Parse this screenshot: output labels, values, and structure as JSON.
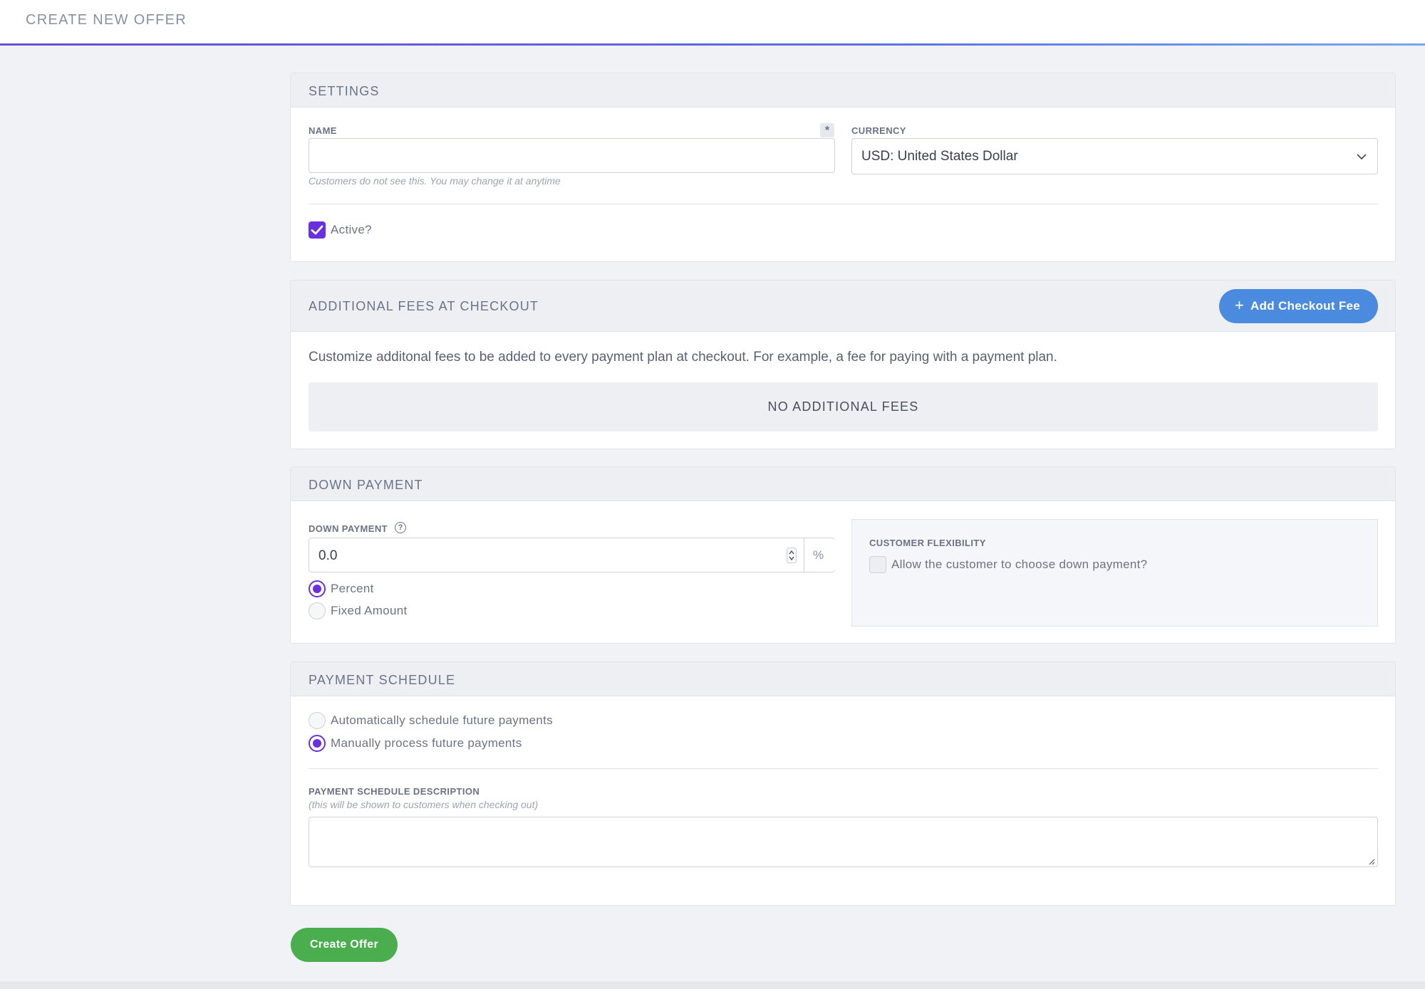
{
  "header": {
    "title": "CREATE NEW OFFER"
  },
  "settings": {
    "title": "SETTINGS",
    "name_label": "NAME",
    "required_marker": "*",
    "name_value": "",
    "name_hint": "Customers do not see this. You may change it at anytime",
    "currency_label": "CURRENCY",
    "currency_value": "USD: United States Dollar",
    "active_label": "Active?",
    "active_checked": true
  },
  "fees": {
    "title": "ADDITIONAL FEES AT CHECKOUT",
    "add_button_plus": "+",
    "add_button_label": "Add Checkout Fee",
    "description": "Customize additonal fees to be added to every payment plan at checkout. For example, a fee for paying with a payment plan.",
    "empty_text": "NO ADDITIONAL FEES"
  },
  "down_payment": {
    "title": "DOWN PAYMENT",
    "field_label": "DOWN PAYMENT",
    "help_glyph": "?",
    "value": "0.0",
    "unit": "%",
    "options": [
      {
        "label": "Percent",
        "selected": true
      },
      {
        "label": "Fixed Amount",
        "selected": false
      }
    ],
    "flex_title": "CUSTOMER FLEXIBILITY",
    "flex_label": "Allow the customer to choose down payment?",
    "flex_checked": false
  },
  "payment_schedule": {
    "title": "PAYMENT SCHEDULE",
    "options": [
      {
        "label": "Automatically schedule future payments",
        "selected": false
      },
      {
        "label": "Manually process future payments",
        "selected": true
      }
    ],
    "desc_label": "PAYMENT SCHEDULE DESCRIPTION",
    "desc_hint": "(this will be shown to customers when checking out)",
    "desc_value": ""
  },
  "actions": {
    "create_label": "Create Offer"
  },
  "colors": {
    "accent": "#6a2fe0",
    "primary_button": "#4a8be0",
    "success_button": "#4aad4e"
  }
}
